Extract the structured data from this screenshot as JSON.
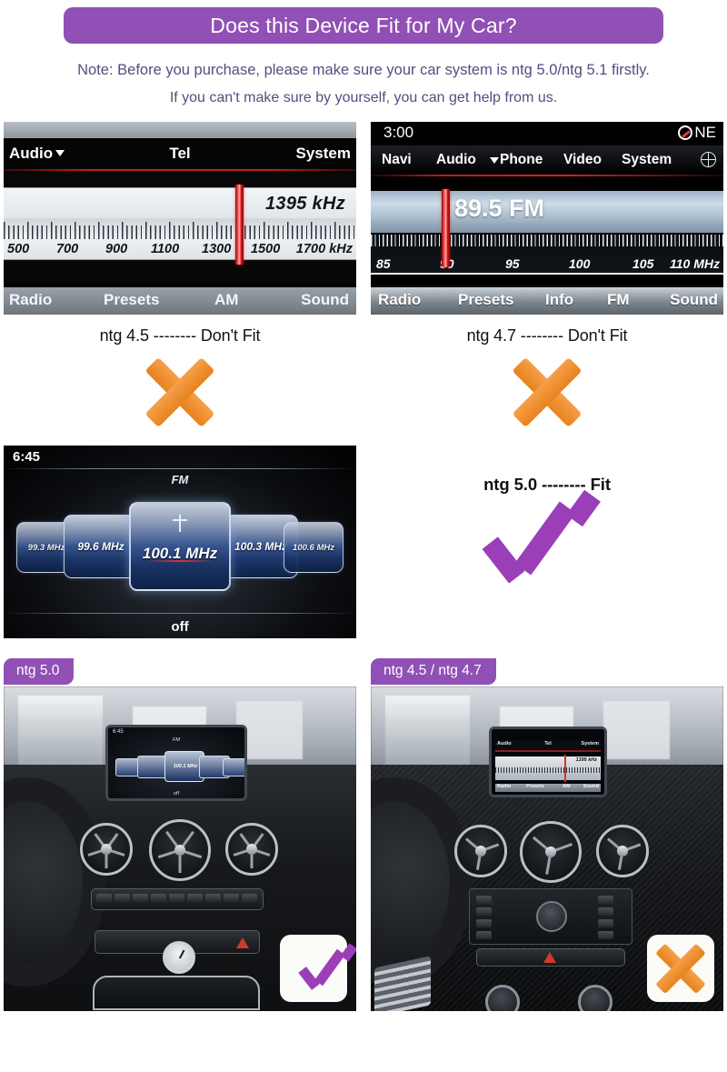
{
  "header": {
    "title": "Does this Device Fit for My Car?",
    "banner_color": "#9150b5"
  },
  "note": {
    "line1": "Note: Before you purchase, please make sure your car system is ntg 5.0/ntg 5.1 firstly.",
    "line2": "If you can't make sure by yourself, you can get help from us.",
    "text_color": "#5b4a80"
  },
  "colors": {
    "purple": "#9150b5",
    "check_purple": "#9a3fb8",
    "orange": "#e8821c"
  },
  "panels": {
    "ntg45": {
      "caption": "ntg 4.5 -------- Don't Fit",
      "verdict": "dont-fit",
      "menu": {
        "audio": "Audio",
        "tel": "Tel",
        "system": "System"
      },
      "readout": "1395 kHz",
      "scale": {
        "ticks": [
          "500",
          "700",
          "900",
          "1100",
          "1300",
          "1500",
          "1700 kHz"
        ],
        "min": 500,
        "max": 1700,
        "marker": 1395,
        "unit": "kHz"
      },
      "bottom": [
        "Radio",
        "Presets",
        "AM",
        "Sound"
      ]
    },
    "ntg47": {
      "caption": "ntg 4.7 -------- Don't Fit",
      "verdict": "dont-fit",
      "clock": "3:00",
      "compass": "NE",
      "menu": [
        "Navi",
        "Audio",
        "Phone",
        "Video",
        "System"
      ],
      "readout": "89.5 FM",
      "scale": {
        "ticks": [
          "85",
          "90",
          "95",
          "100",
          "105",
          "110 MHz"
        ],
        "min": 85,
        "max": 110,
        "marker": 89.5,
        "unit": "MHz"
      },
      "bottom": [
        "Radio",
        "Presets",
        "Info",
        "FM",
        "Sound"
      ]
    },
    "ntg50": {
      "caption": "ntg 5.0 -------- Fit",
      "verdict": "fit",
      "clock": "6:45",
      "band": "FM",
      "off_label": "off",
      "stations": [
        "99.3 MHz",
        "99.6 MHz",
        "100.1 MHz",
        "100.3 MHz",
        "100.6 MHz"
      ],
      "selected_station": "100.1 MHz"
    }
  },
  "photos": {
    "left": {
      "badge": "ntg 5.0",
      "stamp": "check",
      "screen_clock": "6:45",
      "screen_band": "FM",
      "screen_station": "100.1 MHz",
      "screen_off": "off"
    },
    "right": {
      "badge": "ntg 4.5 / ntg 4.7",
      "stamp": "cross",
      "screen_menu": [
        "Audio",
        "Tel",
        "System"
      ],
      "screen_readout": "1395 kHz",
      "screen_bottom": [
        "Radio",
        "Presets",
        "AM",
        "Sound"
      ]
    }
  }
}
